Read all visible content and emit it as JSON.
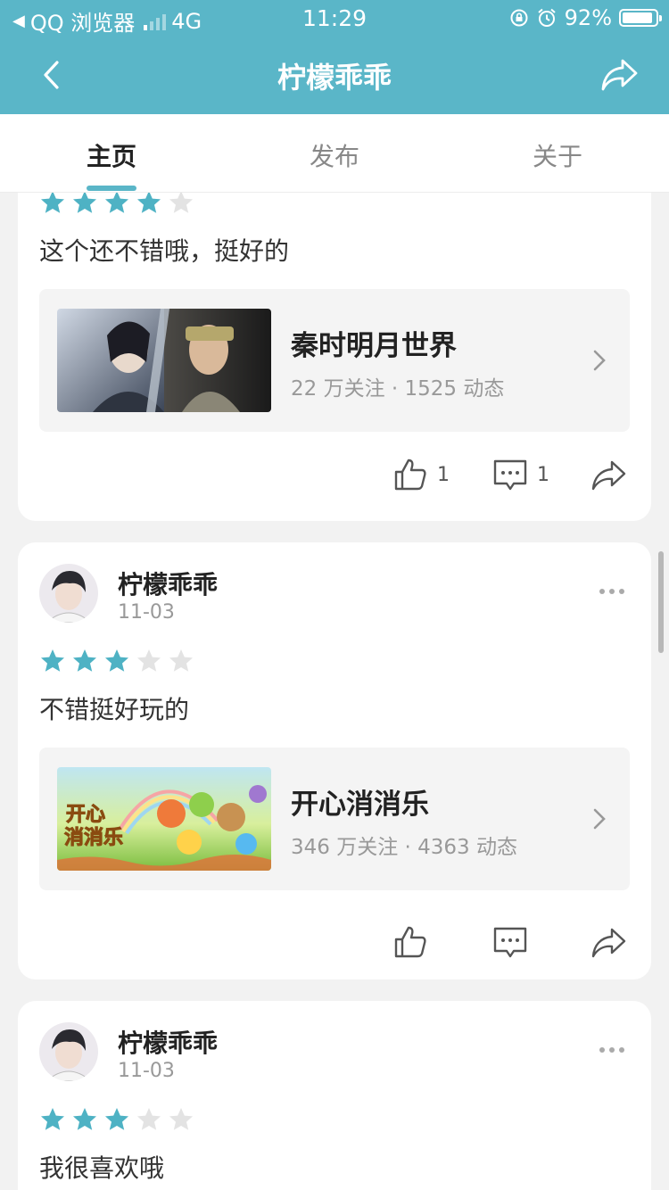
{
  "status_bar": {
    "carrier": "QQ 浏览器",
    "network": "4G",
    "time": "11:29",
    "battery": "92%"
  },
  "nav": {
    "title": "柠檬乖乖"
  },
  "tabs": [
    {
      "label": "主页",
      "active": true
    },
    {
      "label": "发布",
      "active": false
    },
    {
      "label": "关于",
      "active": false
    }
  ],
  "posts": [
    {
      "author": "",
      "date": "",
      "rating": 4,
      "text": "这个还不错哦，挺好的",
      "game": {
        "name": "秦时明月世界",
        "meta": "22 万关注 · 1525 动态"
      },
      "likes": "1",
      "comments": "1"
    },
    {
      "author": "柠檬乖乖",
      "date": "11-03",
      "rating": 3,
      "text": "不错挺好玩的",
      "game": {
        "name": "开心消消乐",
        "meta": "346 万关注 · 4363 动态"
      },
      "likes": "",
      "comments": ""
    },
    {
      "author": "柠檬乖乖",
      "date": "11-03",
      "rating": 3,
      "text": "我很喜欢哦"
    }
  ],
  "colors": {
    "accent": "#5ab6c8",
    "star_on": "#4eb2c4",
    "star_off": "#e3e3e3"
  }
}
